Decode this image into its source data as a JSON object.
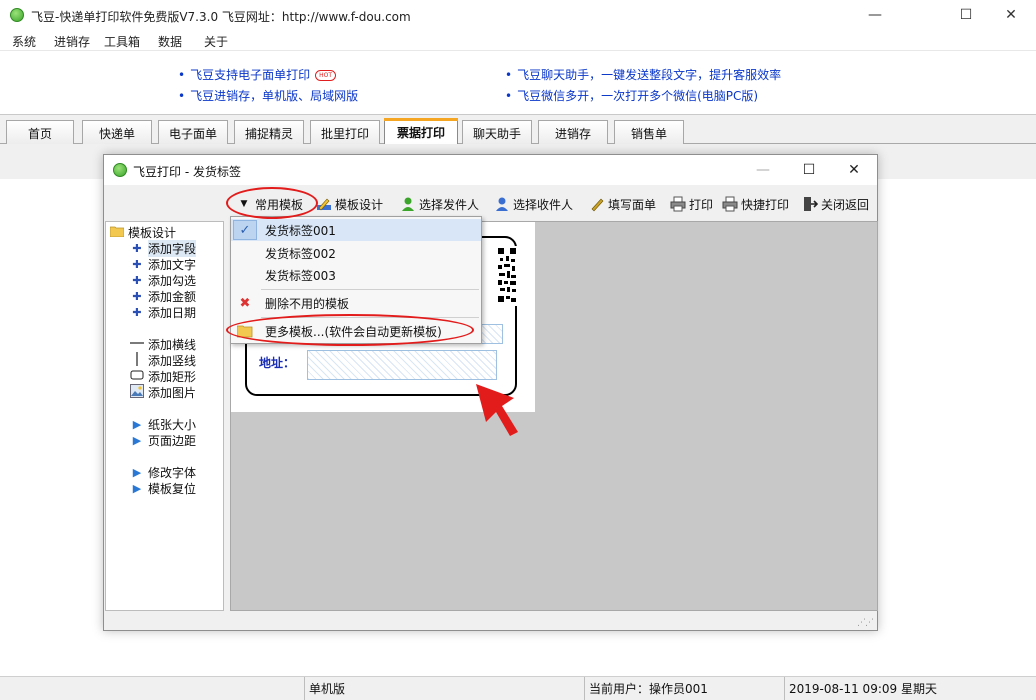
{
  "window": {
    "title": "飞豆-快递单打印软件免费版V7.3.0   飞豆网址：http://www.f-dou.com",
    "controls": {
      "minimize": "—",
      "maximize": "☐",
      "close": "✕"
    }
  },
  "menubar": [
    "系统",
    "进销存",
    "工具箱",
    "数据",
    "关于"
  ],
  "ads": {
    "left": [
      {
        "text": "飞豆支持电子面单打印",
        "badge": "HOT"
      },
      {
        "text": "飞豆进销存，单机版、局域网版"
      }
    ],
    "right": [
      {
        "text": "飞豆聊天助手，一键发送整段文字，提升客服效率"
      },
      {
        "text": "飞豆微信多开，一次打开多个微信(电脑PC版)"
      }
    ]
  },
  "tabs": [
    {
      "label": "首页",
      "active": false
    },
    {
      "label": "快递单",
      "active": false
    },
    {
      "label": "电子面单",
      "active": false
    },
    {
      "label": "捕捉精灵",
      "active": false
    },
    {
      "label": "批里打印",
      "active": false
    },
    {
      "label": "票据打印",
      "active": true
    },
    {
      "label": "聊天助手",
      "active": false
    },
    {
      "label": "进销存",
      "active": false
    },
    {
      "label": "销售单",
      "active": false
    }
  ],
  "dialog": {
    "title": "飞豆打印 - 发货标签",
    "controls": {
      "minimize": "—",
      "maximize": "☐",
      "close": "✕"
    },
    "toolbar": [
      {
        "label": "常用模板",
        "icon": "triangle-down-icon"
      },
      {
        "label": "模板设计",
        "icon": "pencil-design-icon"
      },
      {
        "label": "选择发件人",
        "icon": "user-green-icon"
      },
      {
        "label": "选择收件人",
        "icon": "user-blue-icon"
      },
      {
        "label": "填写面单",
        "icon": "pen-icon"
      },
      {
        "label": "打印",
        "icon": "printer-icon"
      },
      {
        "label": "快捷打印",
        "icon": "printer-icon"
      },
      {
        "label": "关闭返回",
        "icon": "exit-icon"
      }
    ],
    "tree": {
      "root": "模板设计",
      "items": [
        {
          "label": "添加字段",
          "icon": "plus-icon",
          "selected": true
        },
        {
          "label": "添加文字",
          "icon": "plus-icon"
        },
        {
          "label": "添加勾选",
          "icon": "plus-icon"
        },
        {
          "label": "添加金额",
          "icon": "plus-icon"
        },
        {
          "label": "添加日期",
          "icon": "plus-icon"
        },
        {
          "label": "添加横线",
          "icon": "hline-icon"
        },
        {
          "label": "添加竖线",
          "icon": "vline-icon"
        },
        {
          "label": "添加矩形",
          "icon": "rect-icon"
        },
        {
          "label": "添加图片",
          "icon": "image-icon"
        },
        {
          "label": "纸张大小",
          "icon": "triangle-right-icon"
        },
        {
          "label": "页面边距",
          "icon": "triangle-right-icon"
        },
        {
          "label": "修改字体",
          "icon": "triangle-right-icon"
        },
        {
          "label": "模板复位",
          "icon": "triangle-right-icon"
        }
      ]
    },
    "label_preview": {
      "address_label": "地址："
    },
    "dropdown": {
      "items": [
        {
          "label": "发货标签001",
          "checked": true
        },
        {
          "label": "发货标签002"
        },
        {
          "label": "发货标签003"
        },
        {
          "label": "删除不用的模板",
          "icon": "red-x-icon"
        },
        {
          "label": "更多模板...(软件会自动更新模板)",
          "icon": "folder-icon"
        }
      ]
    }
  },
  "statusbar": {
    "mode": "单机版",
    "user": "当前用户：操作员001",
    "datetime": "2019-08-11 09:09 星期天"
  },
  "colors": {
    "link": "#0a37c9",
    "annotation": "#e21b1b",
    "active_tab_accent": "#f5a623"
  }
}
